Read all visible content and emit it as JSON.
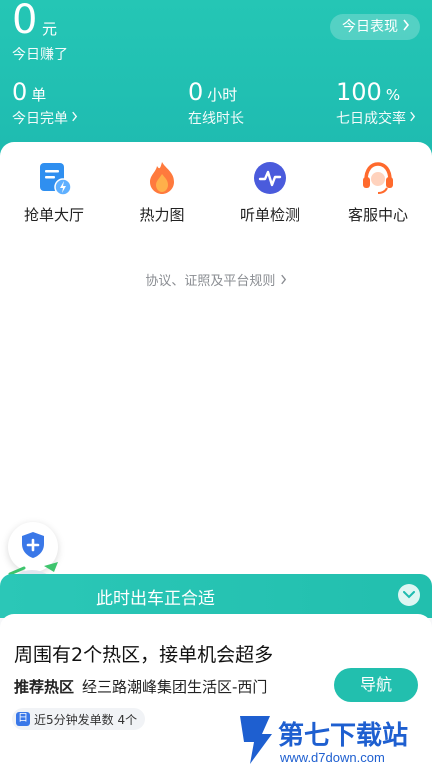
{
  "header": {
    "earn_amount": "0",
    "earn_unit": "元",
    "earn_label": "今日赚了",
    "perf_button": "今日表现",
    "stats": [
      {
        "value": "0",
        "unit": "单",
        "label": "今日完单"
      },
      {
        "value": "0",
        "unit": "小时",
        "label": "在线时长"
      },
      {
        "value": "100",
        "unit": "%",
        "label": "七日成交率"
      }
    ]
  },
  "tools": [
    {
      "label": "抢单大厅",
      "icon": "order-hall-icon"
    },
    {
      "label": "热力图",
      "icon": "flame-icon"
    },
    {
      "label": "听单检测",
      "icon": "pulse-icon"
    },
    {
      "label": "客服中心",
      "icon": "headset-icon"
    }
  ],
  "rules_link": "协议、证照及平台规则",
  "banner": {
    "text": "此时出车正合适"
  },
  "hotspot": {
    "title": "周围有2个热区，接单机会超多",
    "rec_label": "推荐热区",
    "rec_value": "经三路潮峰集团生活区-西门",
    "nav_button": "导航",
    "chip_text": "近5分钟发单数 4个"
  },
  "watermark": {
    "title": "第七下载站",
    "url": "www.d7down.com"
  },
  "colors": {
    "primary": "#22bfae",
    "header": "#25c6b5",
    "blue": "#3a78e8"
  }
}
